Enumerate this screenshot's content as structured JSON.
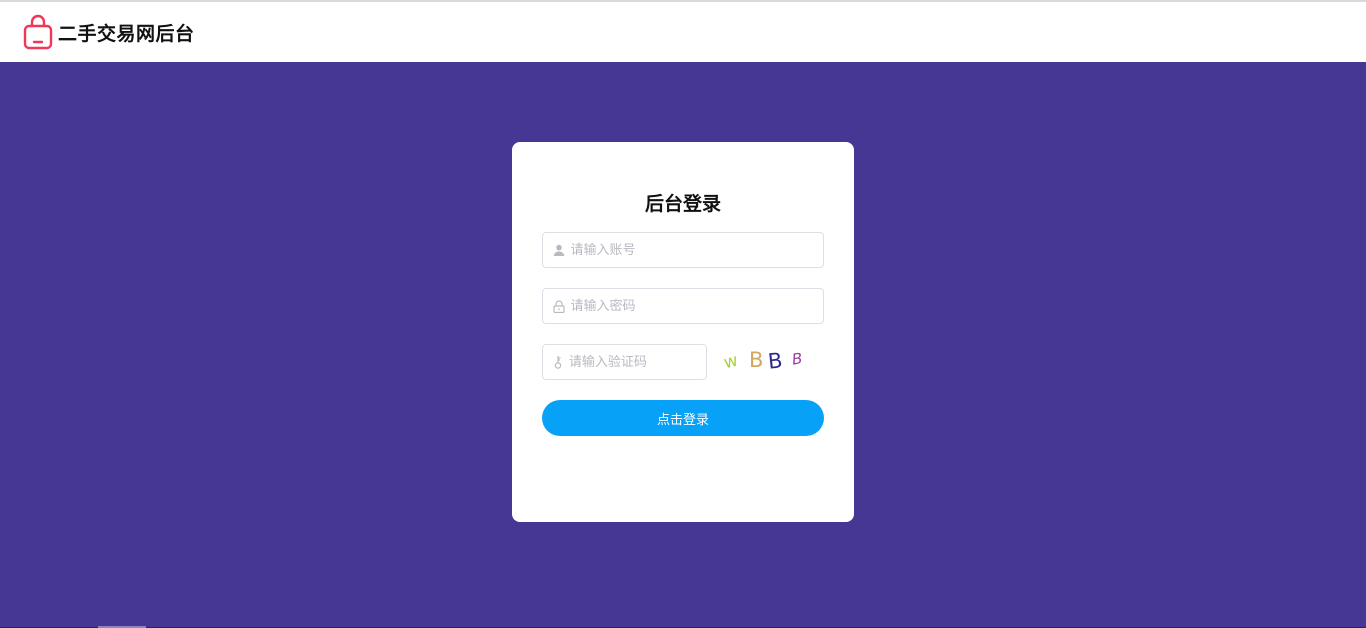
{
  "header": {
    "brand": "二手交易网后台",
    "logo_icon": "shopping-bag-icon",
    "logo_color": "#f2365a"
  },
  "theme": {
    "background": "#473795",
    "button": "#07a2f8"
  },
  "login": {
    "title": "后台登录",
    "username_placeholder": "请输入账号",
    "password_placeholder": "请输入密码",
    "captcha_placeholder": "请输入验证码",
    "captcha_chars": [
      "w",
      "B",
      "B",
      "B"
    ],
    "submit_label": "点击登录",
    "username_icon": "user-icon",
    "password_icon": "lock-icon",
    "captcha_icon": "key-icon"
  }
}
